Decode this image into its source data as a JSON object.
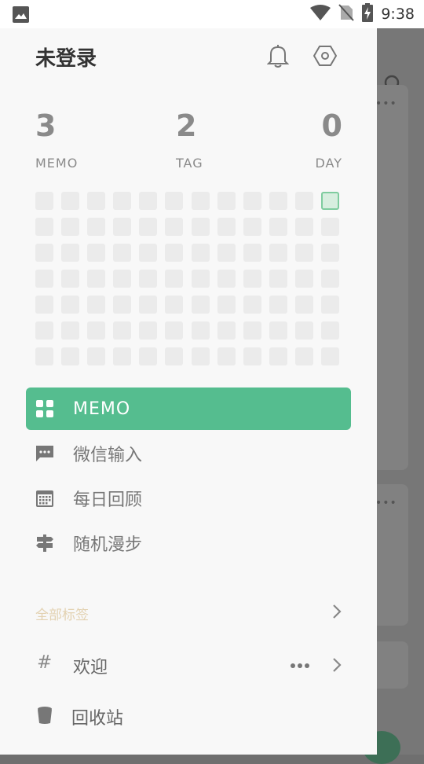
{
  "status_bar": {
    "time": "9:38",
    "icons": [
      "image-notification-icon",
      "wifi-icon",
      "no-sim-icon",
      "battery-charging-icon"
    ]
  },
  "drawer": {
    "user_name": "未登录",
    "header_icons": [
      "bell-icon",
      "settings-hexagon-icon"
    ],
    "stats": [
      {
        "value": "3",
        "label": "MEMO"
      },
      {
        "value": "2",
        "label": "TAG"
      },
      {
        "value": "0",
        "label": "DAY"
      }
    ],
    "heatmap": {
      "rows": 7,
      "cols": 12,
      "active_cells": [
        [
          0,
          11
        ]
      ],
      "empty_color": "#ebebeb",
      "active_color": "#d7eedf"
    },
    "menu": [
      {
        "label": "MEMO",
        "icon": "grid-icon",
        "active": true
      },
      {
        "label": "微信输入",
        "icon": "chat-bubble-icon",
        "active": false
      },
      {
        "label": "每日回顾",
        "icon": "calendar-icon",
        "active": false
      },
      {
        "label": "随机漫步",
        "icon": "signpost-icon",
        "active": false
      }
    ],
    "tags_section": {
      "title": "全部标签"
    },
    "tags": [
      {
        "hash": "#",
        "name": "欢迎"
      }
    ],
    "trash": {
      "label": "回收站",
      "icon": "trash-icon"
    }
  },
  "colors": {
    "accent": "#55bd8f",
    "drawer_bg": "#f8f8f8",
    "scrim": "#6f6f6f",
    "tags_title": "#e3d2b2"
  }
}
